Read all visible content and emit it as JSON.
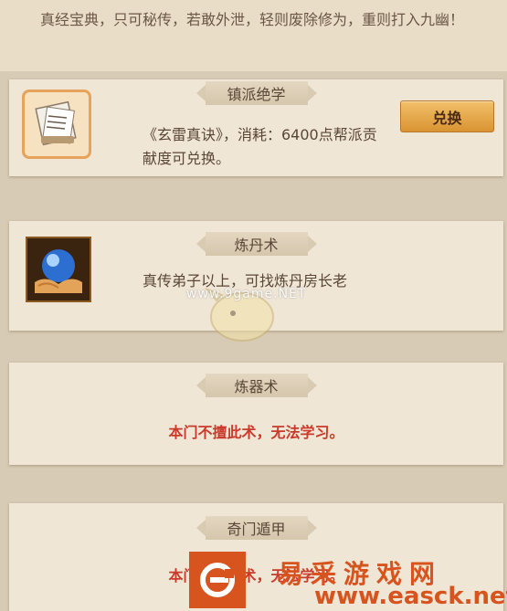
{
  "intro": {
    "text": "真经宝典，只可秘传，若敢外泄，轻则废除修为，重则打入九幽！"
  },
  "cards": [
    {
      "title": "镇派绝学",
      "description": "《玄雷真诀》，消耗：6400点帮派贡献度可兑换。",
      "button_label": "兑换",
      "icon": "book-scroll-icon"
    },
    {
      "title": "炼丹术",
      "description": "真传弟子以上，可找炼丹房长老",
      "icon": "orb-in-hand-icon"
    },
    {
      "title": "炼器术",
      "description": "本门不擅此术，无法学习。"
    },
    {
      "title": "奇门遁甲",
      "description": "本门不擅此术，无法学习。"
    }
  ],
  "watermark": {
    "overlay_text": "www.9game.NET",
    "brand": "易采游戏网",
    "url": "www.easck.net"
  },
  "colors": {
    "card_bg": "#f0e6d6",
    "warning_red": "#c93a2a",
    "button_gold": "#e0a040"
  }
}
